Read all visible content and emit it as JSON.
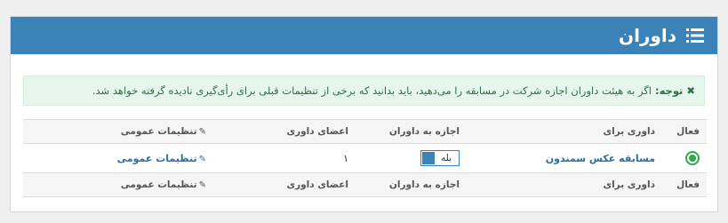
{
  "header": {
    "title": "داوران",
    "icon": "list-icon"
  },
  "notice": {
    "icon": "close-icon",
    "prefix": "توجه:",
    "text": "اگر به هیئت داوران اجازه شرکت در مسابقه را می‌دهید، باید بدانید که برخی از تنظیمات قبلی برای رأی‌گیری نادیده گرفته خواهد شد."
  },
  "table": {
    "columns": {
      "active": "فعال",
      "judging_for": "داوری برای",
      "permit": "اجازه به داوران",
      "members": "اعضای داوری",
      "settings": "تنظیمات عمومی"
    },
    "rows": [
      {
        "active": true,
        "judging_for": "مسابقه عکس سمندون",
        "permit": "بله",
        "members": "۱",
        "settings": "تنظیمات عمومی"
      }
    ]
  },
  "colors": {
    "header_bg": "#3a82b8",
    "notice_bg": "#e6f6ec",
    "notice_text": "#2d6f45",
    "active_green": "#2fa84f",
    "link": "#2a6ea6"
  }
}
